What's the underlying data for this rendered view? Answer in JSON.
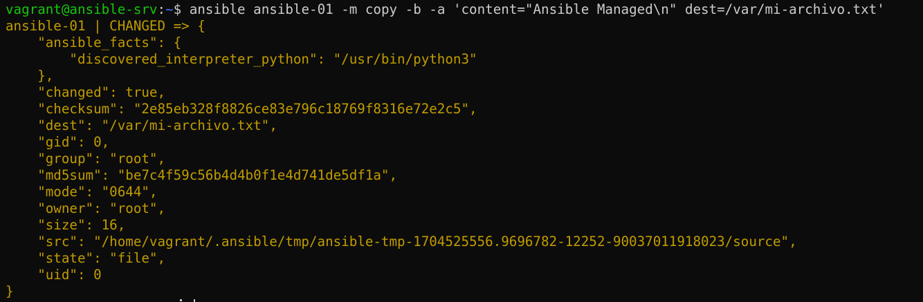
{
  "prompt": {
    "user_host": "vagrant@ansible-srv",
    "separator": ":",
    "cwd": "~",
    "symbol": "$",
    "command": " ansible ansible-01 -m copy -b -a 'content=\"Ansible Managed\\n\" dest=/var/mi-archivo.txt'"
  },
  "output": [
    "ansible-01 | CHANGED => {",
    "    \"ansible_facts\": {",
    "        \"discovered_interpreter_python\": \"/usr/bin/python3\"",
    "    },",
    "    \"changed\": true,",
    "    \"checksum\": \"2e85eb328f8826ce83e796c18769f8316e72e2c5\",",
    "    \"dest\": \"/var/mi-archivo.txt\",",
    "    \"gid\": 0,",
    "    \"group\": \"root\",",
    "    \"md5sum\": \"be7c4f59c56b4d4b0f1e4d741de5df1a\",",
    "    \"mode\": \"0644\",",
    "    \"owner\": \"root\",",
    "    \"size\": 16,",
    "    \"src\": \"/home/vagrant/.ansible/tmp/ansible-tmp-1704525556.9696782-12252-90037011918023/source\",",
    "    \"state\": \"file\",",
    "    \"uid\": 0",
    "}"
  ],
  "colors": {
    "background": "#0c0c0c",
    "user_host": "#16c60c",
    "cwd": "#3b78ff",
    "command": "#cccccc",
    "output": "#c19c00"
  }
}
